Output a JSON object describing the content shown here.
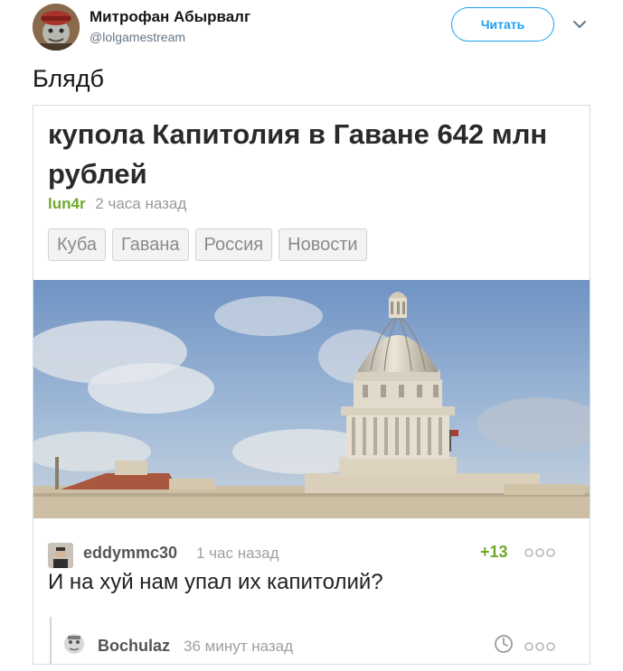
{
  "tweet": {
    "display_name": "Митрофан Абырвалг",
    "handle": "@lolgamestream",
    "follow_label": "Читать",
    "text": "Блядб"
  },
  "post": {
    "title": "купола Капитолия в Гаване 642 млн рублей",
    "author": "lun4r",
    "time": "2 часа назад",
    "tags": [
      "Куба",
      "Гавана",
      "Россия",
      "Новости"
    ]
  },
  "comments": [
    {
      "user": "eddymmc30",
      "time": "1 час назад",
      "rating": "+13",
      "text": "И на хуй нам упал их капитолий?"
    },
    {
      "user": "Bochulaz",
      "time": "36 минут назад"
    }
  ],
  "colors": {
    "twitter_blue": "#1da1f2",
    "pikabu_green": "#6fa92a",
    "tag_text": "#8a8a8a"
  },
  "icons": [
    "avatar",
    "chevron-down-icon",
    "more-dots-icon",
    "clock-icon"
  ]
}
